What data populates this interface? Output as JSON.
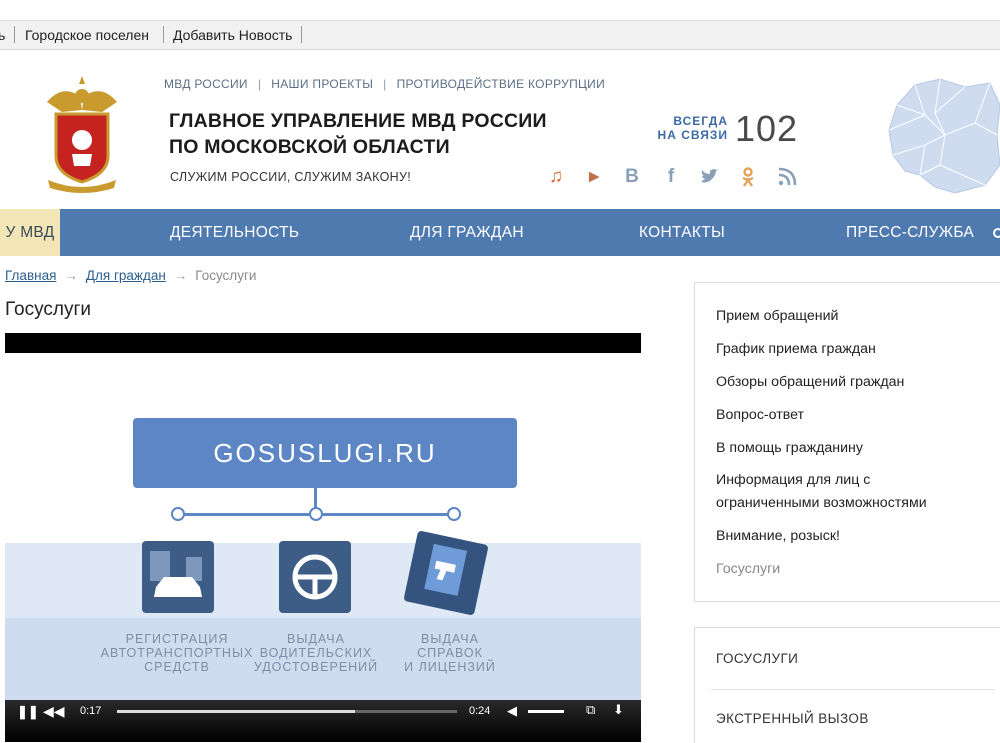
{
  "bookmarks": {
    "items": [
      "ь",
      "Городское поселен",
      "Добавить Новость"
    ]
  },
  "header": {
    "top_links": [
      "МВД РОССИИ",
      "НАШИ ПРОЕКТЫ",
      "ПРОТИВОДЕЙСТВИЕ КОРРУПЦИИ"
    ],
    "title_line1": "ГЛАВНОЕ УПРАВЛЕНИЕ МВД РОССИИ",
    "title_line2": "ПО МОСКОВСКОЙ ОБЛАСТИ",
    "motto": "СЛУЖИМ РОССИИ, СЛУЖИМ ЗАКОНУ!",
    "hotline_label_1": "ВСЕГДА",
    "hotline_label_2": "НА СВЯЗИ",
    "hotline_number": "102",
    "social_icons": [
      "youtube-music-icon",
      "play-icon",
      "vk-icon",
      "facebook-icon",
      "twitter-icon",
      "odnoklassniki-icon",
      "rss-icon"
    ]
  },
  "nav": {
    "items": [
      "У МВД",
      "ДЕЯТЕЛЬНОСТЬ",
      "ДЛЯ ГРАЖДАН",
      "КОНТАКТЫ",
      "ПРЕСС-СЛУЖБА"
    ]
  },
  "breadcrumb": {
    "home": "Главная",
    "section": "Для граждан",
    "current": "Госуслуги"
  },
  "page_title": "Госуслуги",
  "video": {
    "banner": "GOSUSLUGI.RU",
    "caption1": [
      "РЕГИСТРАЦИЯ",
      "АВТОТРАНСПОРТНЫХ",
      "СРЕДСТВ"
    ],
    "caption2": [
      "ВЫДАЧА",
      "ВОДИТЕЛЬСКИХ",
      "УДОСТОВЕРЕНИЙ"
    ],
    "caption3": [
      "ВЫДАЧА",
      "СПРАВОК",
      "И  ЛИЦЕНЗИЙ"
    ],
    "time_current": "0:17",
    "time_total": "0:24",
    "progress_fraction": 0.7
  },
  "sidebar": {
    "links": [
      "Прием обращений",
      "График приема граждан",
      "Обзоры обращений граждан",
      "Вопрос-ответ",
      "В помощь гражданину",
      "Информация для лиц с",
      "ограниченными возможностями",
      "Внимание, розыск!",
      "Госуслуги"
    ],
    "block2": [
      "ГОСУСЛУГИ",
      "ЭКСТРЕННЫЙ ВЫЗОВ"
    ]
  },
  "colors": {
    "nav_bg": "#4f7ab0",
    "nav_active_bg": "#f3e6b6",
    "accent": "#3b6aa6",
    "video_blue": "#5d86c4"
  }
}
